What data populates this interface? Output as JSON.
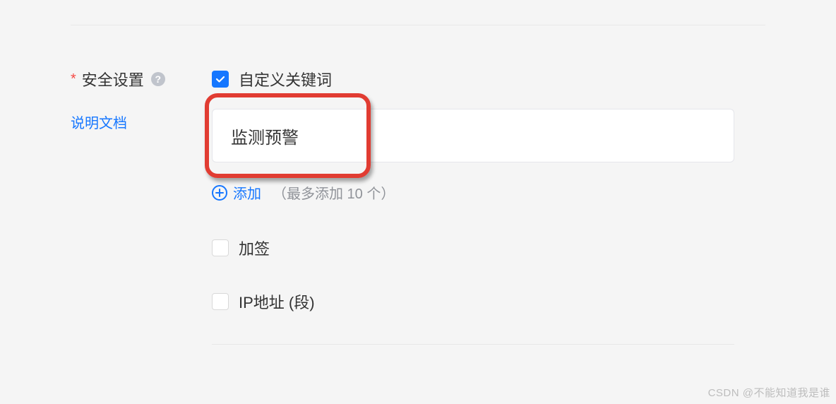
{
  "section": {
    "label": "安全设置",
    "doc_link": "说明文档"
  },
  "options": {
    "custom_keyword": {
      "label": "自定义关键词",
      "checked": true,
      "input_value": "监测预警",
      "add_label": "添加",
      "add_hint": "（最多添加 10 个）"
    },
    "sign": {
      "label": "加签",
      "checked": false
    },
    "ip_range": {
      "label": "IP地址 (段)",
      "checked": false
    }
  },
  "watermark": "CSDN @不能知道我是谁"
}
